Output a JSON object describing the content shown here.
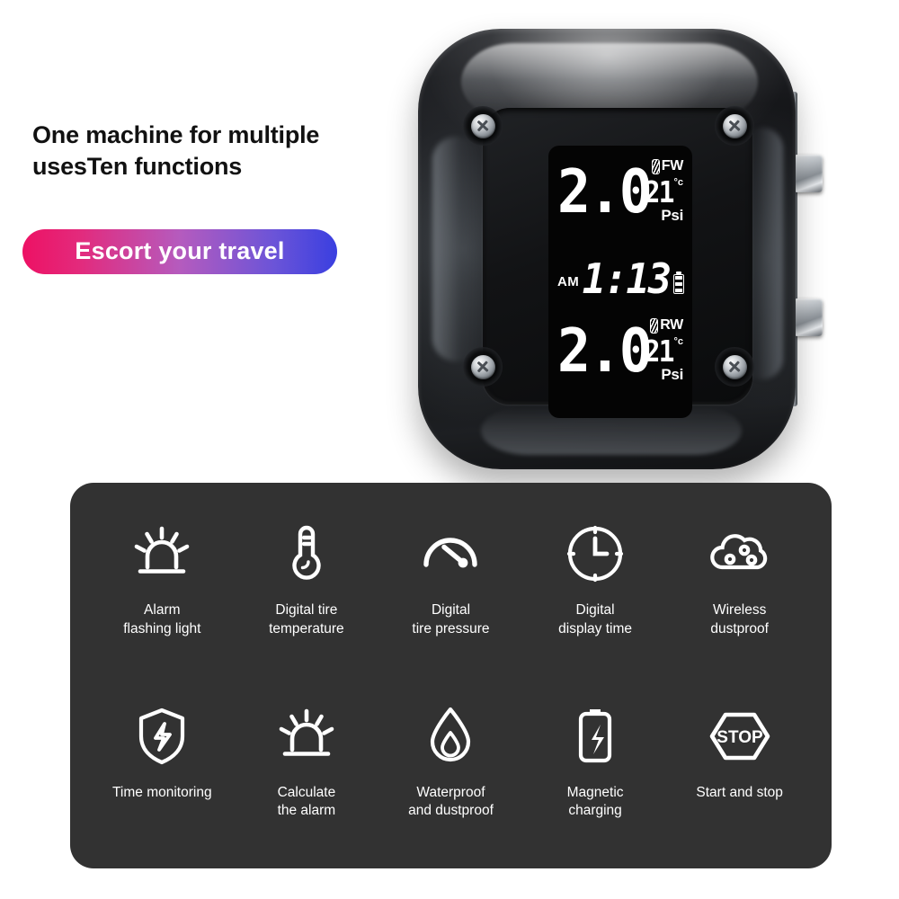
{
  "headline": {
    "line1": "One machine for multiple",
    "line2": "usesTen functions"
  },
  "badge": {
    "text": "Escort your travel",
    "gradient_start": "#ED1164",
    "gradient_end": "#3A3FE0"
  },
  "device": {
    "name": "tire-pressure-monitor",
    "body_color": "#101113",
    "screen": {
      "background": "#040404",
      "segment_color": "#ffffff",
      "front_wheel": {
        "pressure": "2.0",
        "wheel_label": "FW",
        "temperature": "21",
        "temperature_unit": "°c",
        "pressure_unit": "Psi"
      },
      "clock": {
        "meridiem": "AM",
        "time": "1:13",
        "battery_icon": "battery-icon"
      },
      "rear_wheel": {
        "pressure": "2.0",
        "wheel_label": "RW",
        "temperature": "21",
        "temperature_unit": "°c",
        "pressure_unit": "Psi"
      }
    },
    "screws": [
      "screw-top-left",
      "screw-top-right",
      "screw-bottom-left",
      "screw-bottom-right"
    ],
    "connectors": [
      "connector-tab-upper",
      "connector-tab-lower"
    ]
  },
  "features": {
    "panel_background": "#323232",
    "row1": [
      {
        "icon": "siren-light-icon",
        "label": "Alarm\nflashing light"
      },
      {
        "icon": "thermometer-icon",
        "label": "Digital tire\ntemperature"
      },
      {
        "icon": "pressure-gauge-icon",
        "label": "Digital\ntire pressure"
      },
      {
        "icon": "clock-icon",
        "label": "Digital\ndisplay time"
      },
      {
        "icon": "dust-cloud-icon",
        "label": "Wireless\ndustproof"
      }
    ],
    "row2": [
      {
        "icon": "shield-bolt-icon",
        "label": "Time monitoring"
      },
      {
        "icon": "siren-light-icon",
        "label": "Calculate\nthe alarm"
      },
      {
        "icon": "water-drop-icon",
        "label": "Waterproof\nand dustproof"
      },
      {
        "icon": "battery-bolt-icon",
        "label": "Magnetic\ncharging"
      },
      {
        "icon": "stop-sign-icon",
        "label": "Start and stop",
        "glyph_text": "STOP"
      }
    ]
  }
}
